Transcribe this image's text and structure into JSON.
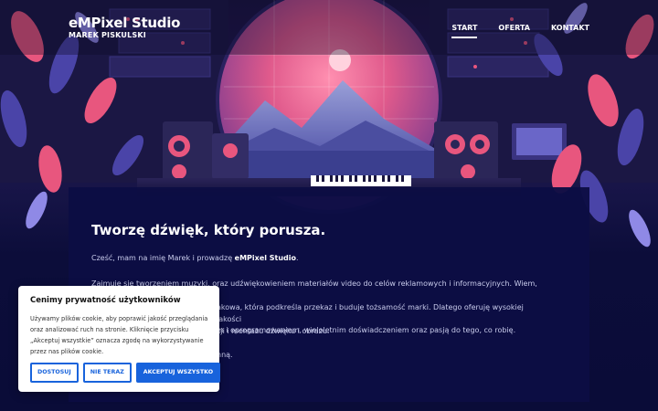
{
  "header": {
    "brand_title": "eMPixel Studio",
    "brand_subtitle": "MAREK PISKULSKI",
    "nav": [
      {
        "label": "START",
        "active": true
      },
      {
        "label": "OFERTA",
        "active": false
      },
      {
        "label": "KONTAKT",
        "active": false
      }
    ]
  },
  "main": {
    "heading": "Tworzę dźwięk, który porusza.",
    "intro_prefix": "Cześć, mam na imię Marek i prowadzę ",
    "intro_brand": "eMPixel Studio",
    "intro_suffix": ".",
    "paragraph_2_line_1": "Zajmuję się tworzeniem muzyki, oraz udźwiękowieniem materiałów video do celów reklamowych i informacyjnych. Wiem, jak",
    "paragraph_2_line_2": "akowa, która podkreśla przekaz i buduje tożsamość marki. Dlatego oferuję wysokiej jakości",
    "paragraph_2_line_3": "cji i montażu dźwięku i obrazu.",
    "paragraph_3": "m i oprogramowaniem, wieloletnim doświadczeniem oraz pasją do tego, co robię.",
    "paragraph_4": "nną."
  },
  "cookie": {
    "title": "Cenimy prywatność użytkowników",
    "text": "Używamy plików cookie, aby poprawić jakość przeglądania oraz analizować ruch na stronie. Kliknięcie przycisku „Akceptuj wszystkie” oznacza zgodę na wykorzystywanie przez nas plików cookie.",
    "buttons": {
      "customize": "DOSTOSUJ",
      "reject": "NIE TERAZ",
      "accept": "AKCEPTUJ WSZYSTKO"
    }
  },
  "colors": {
    "background": "#0a0c38",
    "panel": "#0c0e44",
    "cookie_accent": "#1863dc",
    "hero_pink": "#e8567e"
  }
}
